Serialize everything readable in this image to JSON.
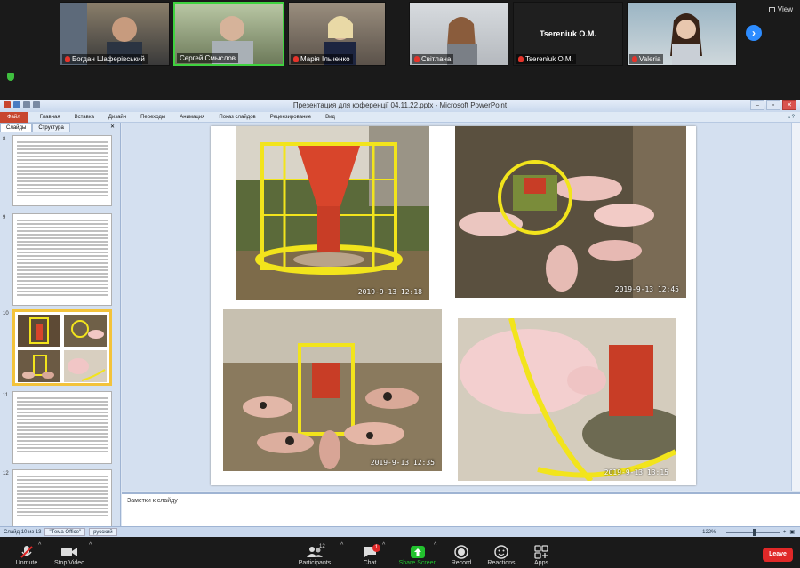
{
  "meeting": {
    "view_label": "View",
    "participants": [
      {
        "name": "Богдан Шаферівський",
        "muted": true
      },
      {
        "name": "Сергей Смыслов",
        "muted": false,
        "active": true
      },
      {
        "name": "Марія Ільченко",
        "muted": true
      },
      {
        "name": "Світлана",
        "muted": true
      },
      {
        "name": "Tsereniuk O.M.",
        "muted": true,
        "video_off": true
      },
      {
        "name": "Valeria",
        "muted": true
      }
    ]
  },
  "ppt": {
    "title": "Презентация для коференції 04.11.22.pptx - Microsoft PowerPoint",
    "file_tab": "Файл",
    "tabs": [
      "Главная",
      "Вставка",
      "Дизайн",
      "Переходы",
      "Анимация",
      "Показ слайдов",
      "Рецензирование",
      "Вид"
    ],
    "pane_tabs": [
      "Слайды",
      "Структура"
    ],
    "slide_numbers": [
      "8",
      "9",
      "10",
      "11",
      "12"
    ],
    "notes_placeholder": "Заметки к слайду",
    "status": {
      "slide_info": "Слайд 10 из 13",
      "theme": "\"Тема Office\"",
      "language": "русский",
      "zoom": "122%"
    }
  },
  "slide": {
    "timestamps": [
      "2019-9-13 12:18",
      "2019-9-13 12:45",
      "2019-9-13 12:35",
      "2019-9-13 13:15"
    ]
  },
  "toolbar": {
    "unmute": "Unmute",
    "stop_video": "Stop Video",
    "participants": "Participants",
    "participants_count": "12",
    "chat": "Chat",
    "chat_badge": "1",
    "share_screen": "Share Screen",
    "record": "Record",
    "reactions": "Reactions",
    "apps": "Apps",
    "leave": "Leave"
  },
  "colors": {
    "share_green": "#22c22e",
    "leave_red": "#e02828",
    "zoom_blue": "#2d8cff",
    "ppt_file_tab": "#c8462e",
    "feeder_yellow": "#f2e41c"
  }
}
